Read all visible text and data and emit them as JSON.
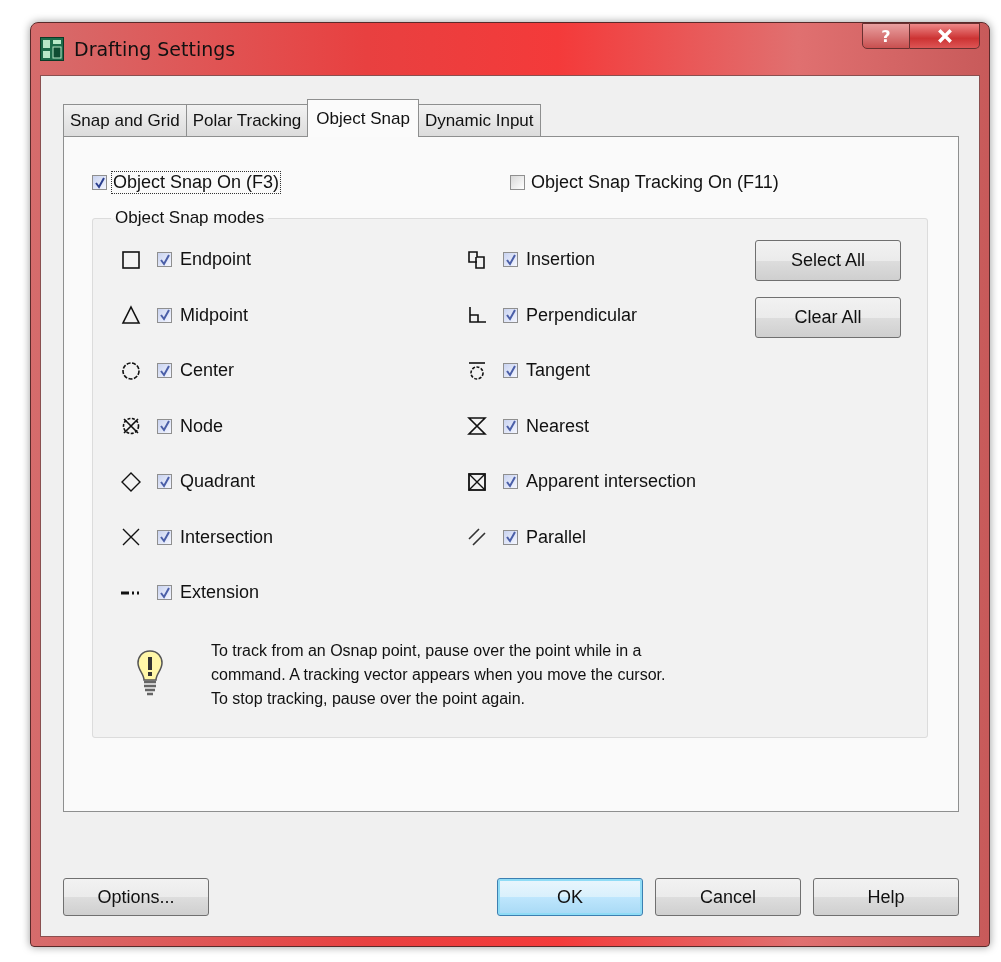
{
  "window": {
    "title": "Drafting Settings",
    "help_button": "?"
  },
  "tabs": [
    {
      "label": "Snap and Grid",
      "selected": false
    },
    {
      "label": "Polar Tracking",
      "selected": false
    },
    {
      "label": "Object Snap",
      "selected": true
    },
    {
      "label": "Dynamic Input",
      "selected": false
    }
  ],
  "options": [
    {
      "label": "Object Snap On (F3)",
      "checked": true,
      "focused": true
    },
    {
      "label": "Object Snap Tracking On (F11)",
      "checked": false,
      "focused": false
    }
  ],
  "modes_group": {
    "title": "Object Snap modes"
  },
  "modes_left": [
    {
      "label": "Endpoint",
      "checked": true
    },
    {
      "label": "Midpoint",
      "checked": true
    },
    {
      "label": "Center",
      "checked": true
    },
    {
      "label": "Node",
      "checked": true
    },
    {
      "label": "Quadrant",
      "checked": true
    },
    {
      "label": "Intersection",
      "checked": true
    },
    {
      "label": "Extension",
      "checked": true
    }
  ],
  "modes_right": [
    {
      "label": "Insertion",
      "checked": true
    },
    {
      "label": "Perpendicular",
      "checked": true
    },
    {
      "label": "Tangent",
      "checked": true
    },
    {
      "label": "Nearest",
      "checked": true
    },
    {
      "label": "Apparent intersection",
      "checked": true
    },
    {
      "label": "Parallel",
      "checked": true
    }
  ],
  "mode_buttons": [
    "Select All",
    "Clear All"
  ],
  "tip": "To track from an Osnap point, pause over the point while in a\ncommand.  A tracking vector appears when you move the cursor.\nTo stop tracking, pause over the point again.",
  "buttons": [
    {
      "label": "Options...",
      "default": false
    },
    {
      "label": "OK",
      "default": true
    },
    {
      "label": "Cancel",
      "default": false
    },
    {
      "label": "Help",
      "default": false
    }
  ]
}
